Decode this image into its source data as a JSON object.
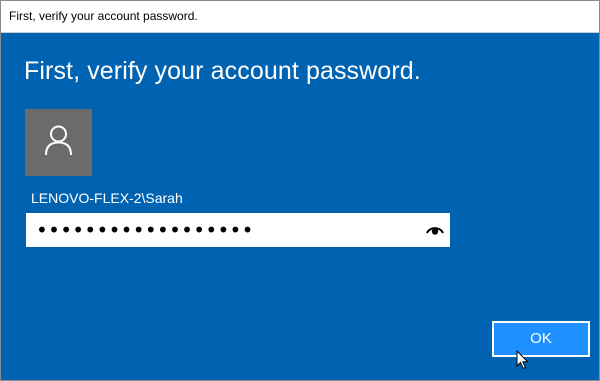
{
  "window": {
    "title": "First, verify your account password."
  },
  "dialog": {
    "heading": "First, verify your account password.",
    "avatar_icon": "user-icon",
    "username": "LENOVO-FLEX-2\\Sarah",
    "password_value": "••••••••••••••••••",
    "reveal_icon": "eye-icon",
    "ok_label": "OK"
  },
  "colors": {
    "background": "#0063b1",
    "avatar_bg": "#6b6b6b",
    "ok_button": "#1e90ff"
  }
}
